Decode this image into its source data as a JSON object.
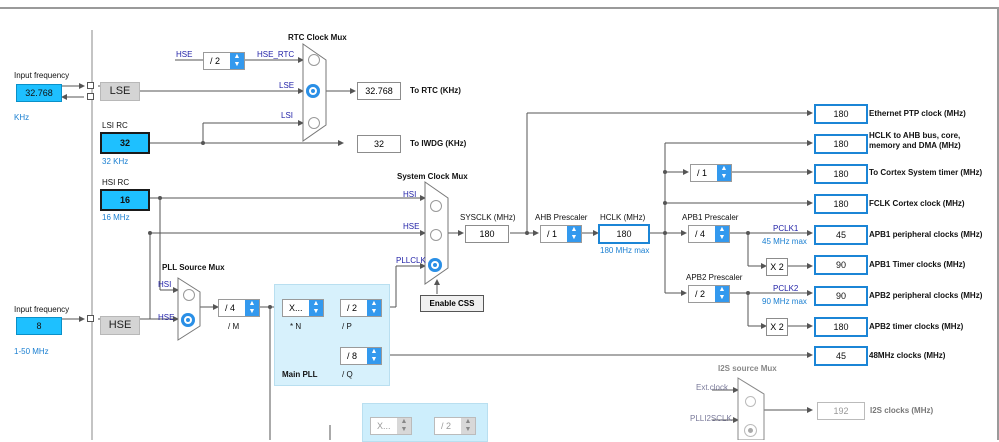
{
  "lse": {
    "input_label": "Input frequency",
    "input_value": "32.768",
    "unit": "KHz",
    "osc_label": "LSE"
  },
  "lsi": {
    "title": "LSI RC",
    "value": "32",
    "range": "32 KHz"
  },
  "hsi": {
    "title": "HSI RC",
    "value": "16",
    "range": "16 MHz"
  },
  "hse": {
    "input_label": "Input frequency",
    "input_value": "8",
    "range": "1-50 MHz",
    "osc_label": "HSE"
  },
  "rtc_mux": {
    "title": "RTC Clock Mux",
    "hse_div": "/ 2",
    "in_hse": "HSE",
    "in_hse_rtc": "HSE_RTC",
    "in_lse": "LSE",
    "in_lsi": "LSI",
    "rtc_value": "32.768",
    "rtc_label": "To RTC (KHz)",
    "iwdg_value": "32",
    "iwdg_label": "To IWDG (KHz)"
  },
  "sys_mux": {
    "title": "System Clock Mux",
    "in_hsi": "HSI",
    "in_hse": "HSE",
    "in_pllclk": "PLLCLK",
    "enable_css": "Enable CSS",
    "sysclk_label": "SYSCLK (MHz)",
    "sysclk_value": "180"
  },
  "ahb": {
    "label": "AHB Prescaler",
    "div": "/ 1",
    "hclk_label": "HCLK (MHz)",
    "hclk_value": "180",
    "hclk_max": "180 MHz max"
  },
  "apb1": {
    "label": "APB1 Prescaler",
    "div": "/ 4",
    "pclk": "PCLK1",
    "max": "45 MHz max",
    "mult": "X 2"
  },
  "apb2": {
    "label": "APB2 Prescaler",
    "div": "/ 2",
    "pclk": "PCLK2",
    "max": "90 MHz max",
    "mult": "X 2"
  },
  "cortex_div": "/ 1",
  "pll": {
    "source_title": "PLL Source Mux",
    "in_hsi": "HSI",
    "in_hse": "HSE",
    "m_div": "/ 4",
    "m_label": "/ M",
    "n_mul": "X...",
    "n_label": "* N",
    "p_div": "/ 2",
    "p_label": "/ P",
    "q_div": "/ 8",
    "q_label": "/ Q",
    "title": "Main PLL"
  },
  "outputs": [
    {
      "value": "180",
      "label": "Ethernet PTP clock (MHz)"
    },
    {
      "value": "180",
      "label": "HCLK to AHB bus, core,",
      "label2": "memory and DMA (MHz)"
    },
    {
      "value": "180",
      "label": "To Cortex System timer (MHz)"
    },
    {
      "value": "180",
      "label": "FCLK Cortex clock (MHz)"
    },
    {
      "value": "45",
      "label": "APB1 peripheral clocks (MHz)"
    },
    {
      "value": "90",
      "label": "APB1 Timer clocks (MHz)"
    },
    {
      "value": "90",
      "label": "APB2 peripheral clocks (MHz)"
    },
    {
      "value": "180",
      "label": "APB2 timer clocks (MHz)"
    },
    {
      "value": "45",
      "label": "48MHz clocks (MHz)"
    }
  ],
  "i2s": {
    "title": "I2S source Mux",
    "in_ext": "Ext.clock",
    "in_plli2s": "PLLI2SCLK",
    "value": "192",
    "label": "I2S clocks (MHz)",
    "n_mul": "X...",
    "r_div": "/ 2"
  },
  "colors": {
    "accent_blue": "#1b85d6",
    "input_cyan": "#1ec0ff",
    "pll_fill": "#d7f1fc",
    "signal_text": "#2323a8"
  }
}
